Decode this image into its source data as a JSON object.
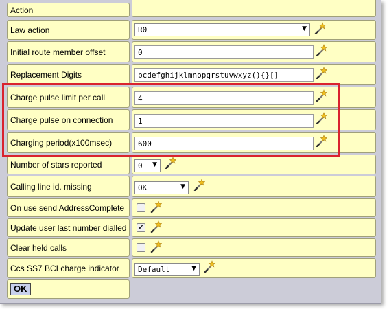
{
  "section": {
    "title": "Action"
  },
  "rows": {
    "law_action": {
      "label": "Law action",
      "value": "R0"
    },
    "initial_route": {
      "label": "Initial route member offset",
      "value": "0"
    },
    "replacement_digits": {
      "label": "Replacement Digits",
      "value": "bcdefghijklmnopqrstuvwxyz(){}[]"
    },
    "charge_limit": {
      "label": "Charge pulse limit per call",
      "value": "4"
    },
    "charge_connection": {
      "label": "Charge pulse on connection",
      "value": "1"
    },
    "charging_period": {
      "label": "Charging period(x100msec)",
      "value": "600"
    },
    "stars_reported": {
      "label": "Number of stars reported",
      "value": "0"
    },
    "calling_line": {
      "label": "Calling line id. missing",
      "value": "OK"
    },
    "send_address": {
      "label": "On use send AddressComplete",
      "checked": false
    },
    "update_user": {
      "label": "Update user last number dialled",
      "checked": true
    },
    "clear_held": {
      "label": "Clear held calls",
      "checked": false
    },
    "ccs_ss7": {
      "label": "Ccs SS7 BCI charge indicator",
      "value": "Default"
    }
  },
  "buttons": {
    "ok": "OK"
  },
  "glyphs": {
    "dropdown_arrow": "▼",
    "check_mark": "✔"
  },
  "icons": {
    "wand": "magic-wand-icon"
  },
  "colors": {
    "frame_bg": "#ccccd8",
    "cell_bg": "#ffffc4",
    "highlight": "#d9232e",
    "ok_bg": "#c8d0ec"
  }
}
